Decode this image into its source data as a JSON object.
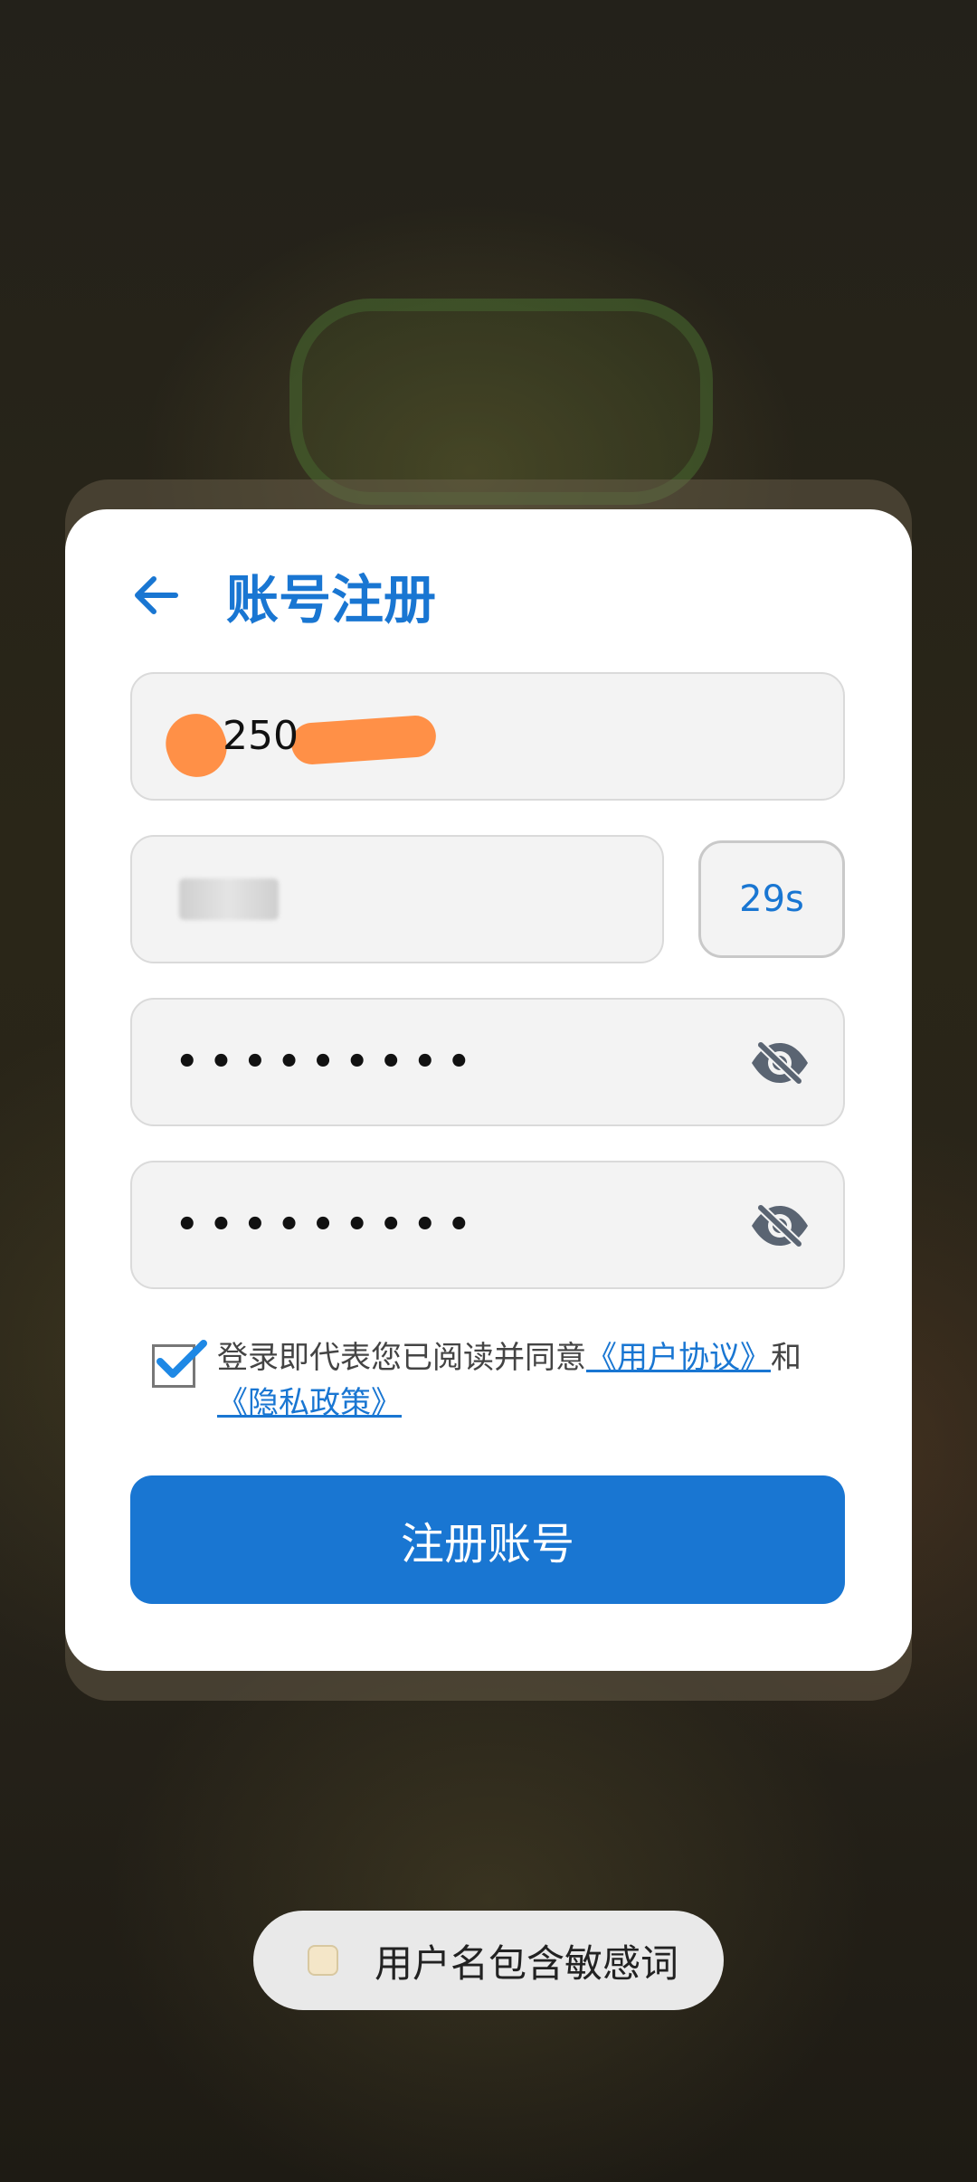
{
  "dialog": {
    "title": "账号注册",
    "phone_value": "250",
    "timer_label": "29s",
    "password_mask": "•••••••••",
    "confirm_password_mask": "•••••••••",
    "agreement": {
      "text_before": "登录即代表您已阅读并同意",
      "user_agreement_link": "《用户协议》",
      "conjunction": "和",
      "privacy_policy_link": "《隐私政策》",
      "checked": true
    },
    "submit_label": "注册账号"
  },
  "toast": {
    "message": "用户名包含敏感词"
  },
  "colors": {
    "accent": "#1976d2",
    "redaction": "#ff8a3d"
  }
}
